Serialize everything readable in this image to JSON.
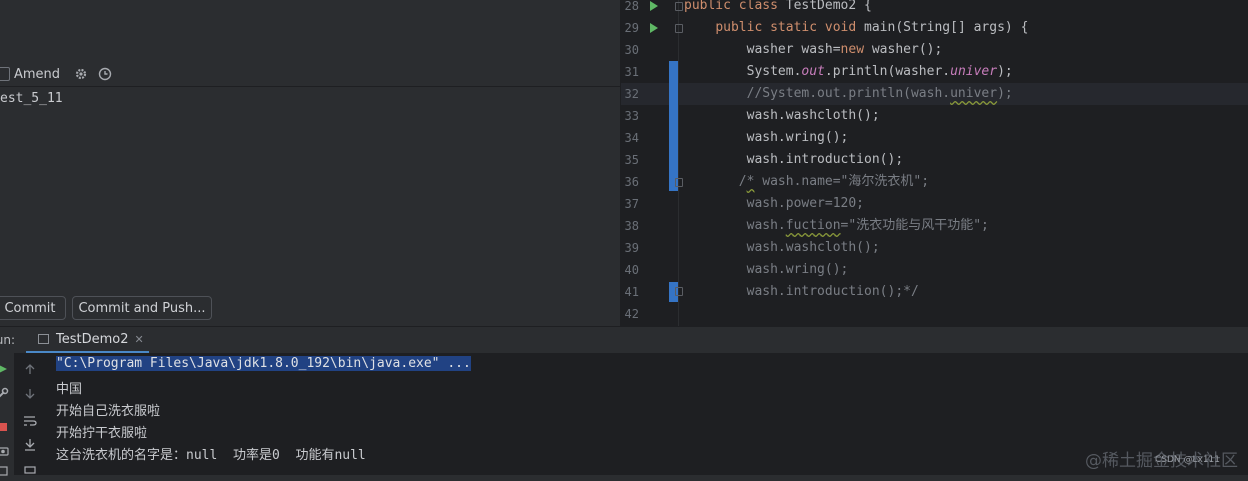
{
  "commit_panel": {
    "amend_label": "Amend",
    "message": "est_5_11",
    "commit_button": "Commit",
    "commit_push_button": "Commit and Push..."
  },
  "editor": {
    "lines": [
      {
        "num": "28",
        "parts": [
          [
            "kw",
            "public class "
          ],
          [
            "",
            "TestDemo2 {"
          ]
        ]
      },
      {
        "num": "29",
        "parts": [
          [
            "",
            "    "
          ],
          [
            "kw",
            "public static void "
          ],
          [
            "",
            "main(String[] args) {"
          ]
        ]
      },
      {
        "num": "30",
        "parts": [
          [
            "",
            "        washer wash="
          ],
          [
            "kw",
            "new "
          ],
          [
            "",
            "washer();"
          ]
        ]
      },
      {
        "num": "31",
        "parts": [
          [
            "",
            "        System."
          ],
          [
            "fld",
            "out"
          ],
          [
            "",
            ".println(washer."
          ],
          [
            "fld",
            "univer"
          ],
          [
            "",
            ");"
          ]
        ]
      },
      {
        "num": "32",
        "parts": [
          [
            "cm",
            "        //System.out.println(wash."
          ],
          [
            "cmw",
            "univer"
          ],
          [
            "cm",
            ");"
          ]
        ]
      },
      {
        "num": "33",
        "parts": [
          [
            "",
            "        wash.washcloth();"
          ]
        ]
      },
      {
        "num": "34",
        "parts": [
          [
            "",
            "        wash.wring();"
          ]
        ]
      },
      {
        "num": "35",
        "parts": [
          [
            "",
            "        wash.introduction();"
          ]
        ]
      },
      {
        "num": "36",
        "parts": [
          [
            "cm",
            "       /"
          ],
          [
            "cmw",
            "*"
          ],
          [
            "cm",
            " wash.name=\"海尔洗衣机\";"
          ]
        ]
      },
      {
        "num": "37",
        "parts": [
          [
            "cm",
            "        wash.power=120;"
          ]
        ]
      },
      {
        "num": "38",
        "parts": [
          [
            "cm",
            "        wash."
          ],
          [
            "cmw",
            "fuction"
          ],
          [
            "cm",
            "=\"洗衣功能与风干功能\";"
          ]
        ]
      },
      {
        "num": "39",
        "parts": [
          [
            "cm",
            "        wash.washcloth();"
          ]
        ]
      },
      {
        "num": "40",
        "parts": [
          [
            "cm",
            "        wash.wring();"
          ]
        ]
      },
      {
        "num": "41",
        "parts": [
          [
            "cm",
            "        wash.introduction();*/"
          ]
        ]
      },
      {
        "num": "42",
        "parts": [
          [
            "",
            ""
          ]
        ]
      }
    ]
  },
  "run_panel": {
    "label": "Run:",
    "tab_title": "TestDemo2",
    "output": [
      "\"C:\\Program Files\\Java\\jdk1.8.0_192\\bin\\java.exe\" ...",
      "中国",
      "开始自己洗衣服啦",
      "开始拧干衣服啦",
      "这台洗衣机的名字是：null  功率是0  功能有null"
    ]
  },
  "watermark": {
    "main": "@稀土掘金技术社区",
    "small": "CSDN @Lx111"
  }
}
